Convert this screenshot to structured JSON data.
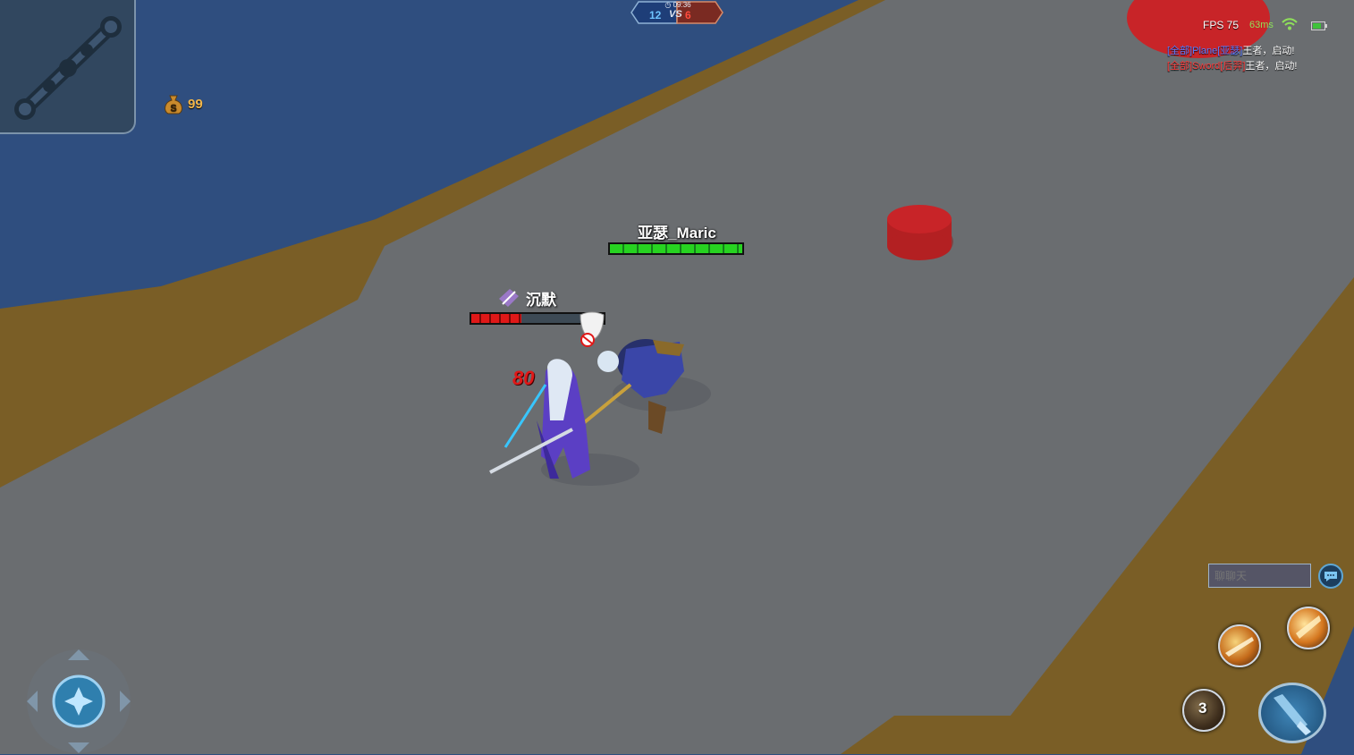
{
  "hud": {
    "gold": "99",
    "gold_icon_letter": "S",
    "match_timer": "09:36",
    "team_score": "12",
    "vs_label": "VS",
    "enemy_score": "6",
    "fps_label": "FPS 75",
    "ping_label": "63ms"
  },
  "kill_feed": [
    {
      "player": "[全部]Plane[亚瑟]",
      "message": "王者，启动!"
    },
    {
      "player": "[全部]Sword[后羿]",
      "message": "王者，启动!"
    }
  ],
  "units": {
    "ally": {
      "name": "亚瑟_Maric",
      "hp_fraction": 1.0
    },
    "enemy": {
      "status_effect": "沉默",
      "hp_fraction": 0.38
    },
    "damage_number": "80"
  },
  "chat": {
    "placeholder": "聊聊天"
  },
  "skills": {
    "cooldown_value": "3"
  },
  "colors": {
    "water": "#2f4e7f",
    "floor": "#6a6d70",
    "wall": "#7a5e26",
    "ally_hp": "#27d321",
    "enemy_hp": "#e01818",
    "team_score": "#6fc4ff",
    "enemy_score": "#ff4b3d"
  }
}
